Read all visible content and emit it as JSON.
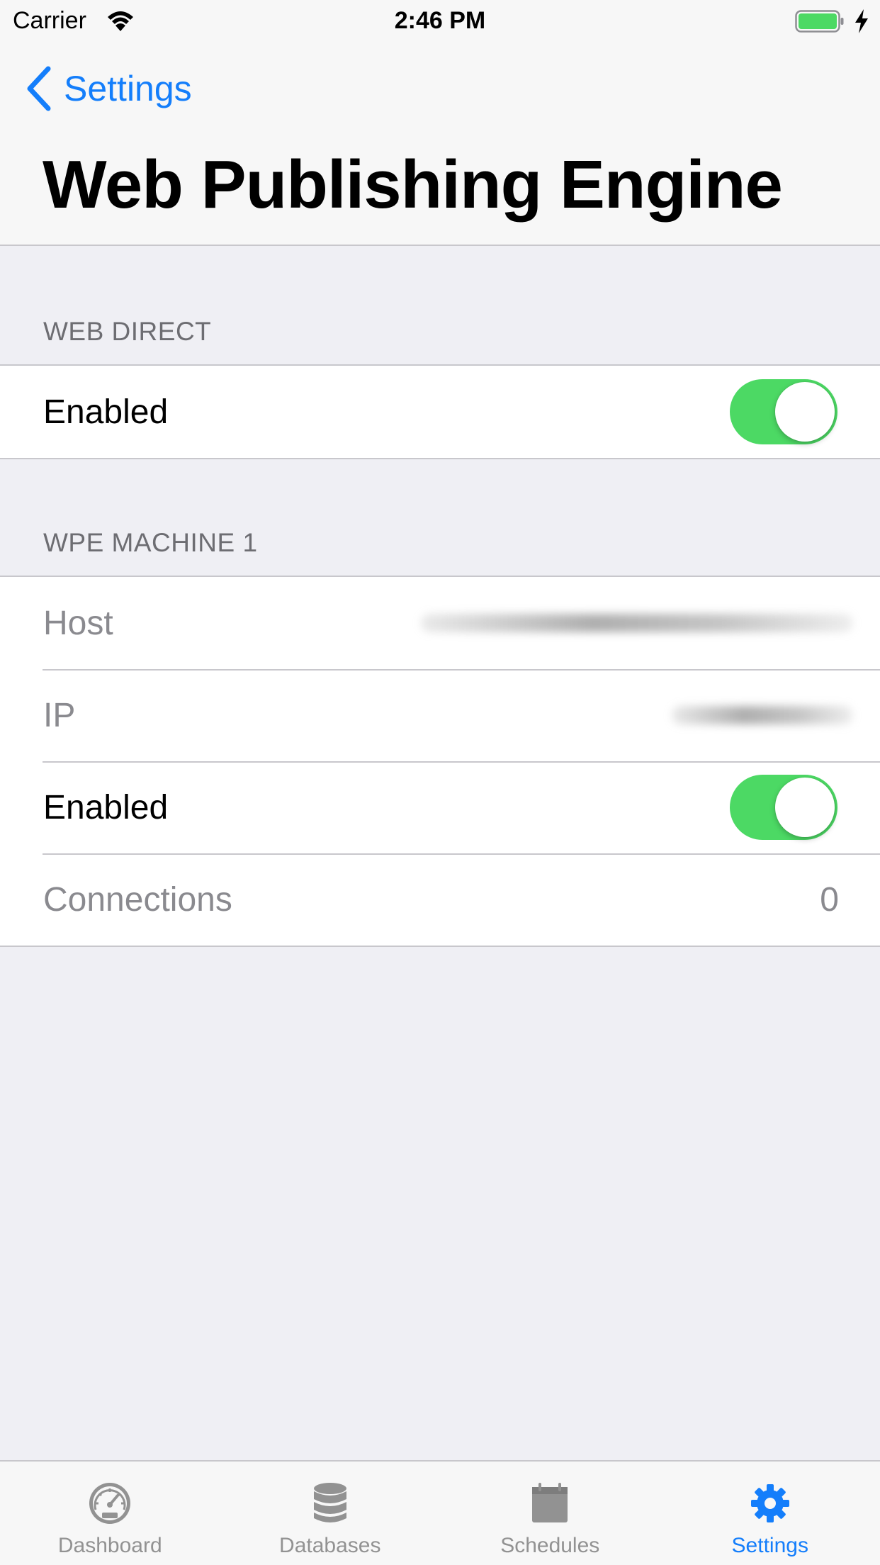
{
  "status_bar": {
    "carrier": "Carrier",
    "time": "2:46 PM"
  },
  "nav": {
    "back_label": "Settings",
    "title": "Web Publishing Engine"
  },
  "sections": {
    "web_direct": {
      "header": "WEB DIRECT",
      "enabled_label": "Enabled",
      "enabled": true
    },
    "wpe_machine_1": {
      "header": "WPE MACHINE 1",
      "host_label": "Host",
      "ip_label": "IP",
      "enabled_label": "Enabled",
      "enabled": true,
      "connections_label": "Connections",
      "connections_value": "0"
    }
  },
  "tab_bar": {
    "tabs": [
      {
        "label": "Dashboard",
        "icon": "speedometer-icon",
        "active": false
      },
      {
        "label": "Databases",
        "icon": "database-icon",
        "active": false
      },
      {
        "label": "Schedules",
        "icon": "calendar-icon",
        "active": false
      },
      {
        "label": "Settings",
        "icon": "gear-icon",
        "active": true
      }
    ]
  },
  "colors": {
    "accent": "#147efb",
    "toggle_on": "#4cd964",
    "background": "#efeff4",
    "tab_inactive": "#929292"
  }
}
